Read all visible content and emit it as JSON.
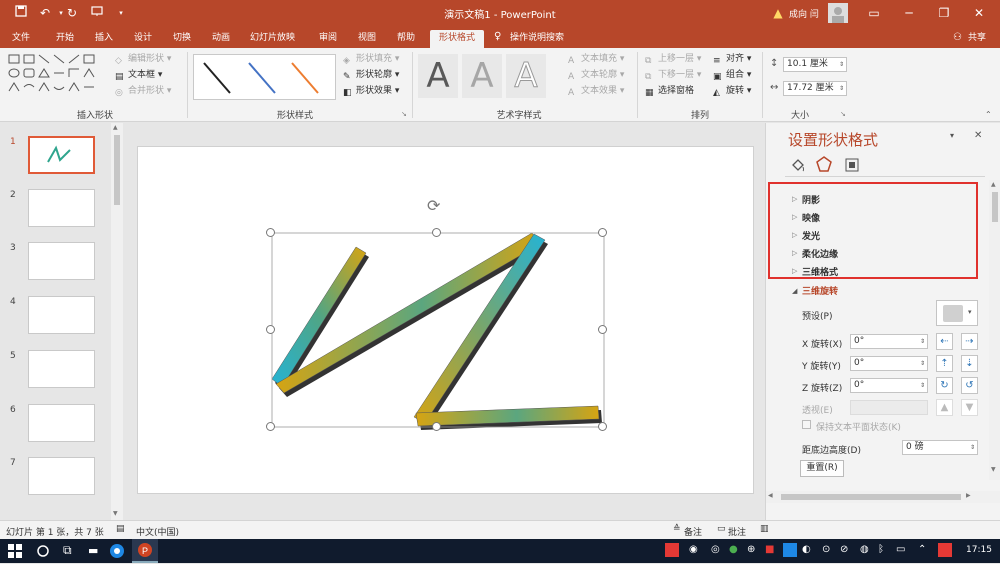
{
  "titlebar": {
    "title": "演示文稿1 - PowerPoint",
    "warning": "成向 闫"
  },
  "tabs": [
    "文件",
    "开始",
    "插入",
    "设计",
    "切换",
    "动画",
    "幻灯片放映",
    "审阅",
    "视图",
    "帮助",
    "形状格式"
  ],
  "tell_me": "操作说明搜索",
  "share": "共享",
  "ribbon": {
    "insert_shapes": {
      "label": "插入形状",
      "edit_shape": "编辑形状",
      "textbox": "文本框",
      "merge_shapes": "合并形状"
    },
    "shape_styles": {
      "label": "形状样式",
      "fill": "形状填充",
      "outline": "形状轮廓",
      "effects": "形状效果"
    },
    "wordart": {
      "label": "艺术字样式",
      "text_fill": "文本填充",
      "text_outline": "文本轮廓",
      "text_effects": "文本效果",
      "sample": "A"
    },
    "arrange": {
      "label": "排列",
      "bring_forward": "上移一层",
      "send_backward": "下移一层",
      "selection_pane": "选择窗格",
      "align": "对齐",
      "group": "组合",
      "rotate": "旋转"
    },
    "size": {
      "label": "大小",
      "height": "10.1 厘米",
      "width": "17.72 厘米"
    }
  },
  "thumbnails": [
    "1",
    "2",
    "3",
    "4",
    "5",
    "6",
    "7"
  ],
  "pane": {
    "title": "设置形状格式",
    "sections": [
      "阴影",
      "映像",
      "发光",
      "柔化边缘",
      "三维格式",
      "三维旋转"
    ],
    "preset_label": "预设(P)",
    "x_label": "X 旋转(X)",
    "x_value": "0°",
    "y_label": "Y 旋转(Y)",
    "y_value": "0°",
    "z_label": "Z 旋转(Z)",
    "z_value": "0°",
    "perspective_label": "透视(E)",
    "keep_flat": "保持文本平面状态(K)",
    "distance_label": "距底边高度(D)",
    "distance_value": "0 磅",
    "reset": "重置(R)"
  },
  "status": {
    "slide_info": "幻灯片 第 1 张，共 7 张",
    "language": "中文(中国)",
    "notes": "备注",
    "comments": "批注"
  },
  "taskbar": {
    "time": "17:15"
  },
  "colors": {
    "accent": "#b7472a",
    "ribbon_bg": "#f3f3f3",
    "pane_title": "#b7472a",
    "highlight_box": "#e0312d"
  }
}
